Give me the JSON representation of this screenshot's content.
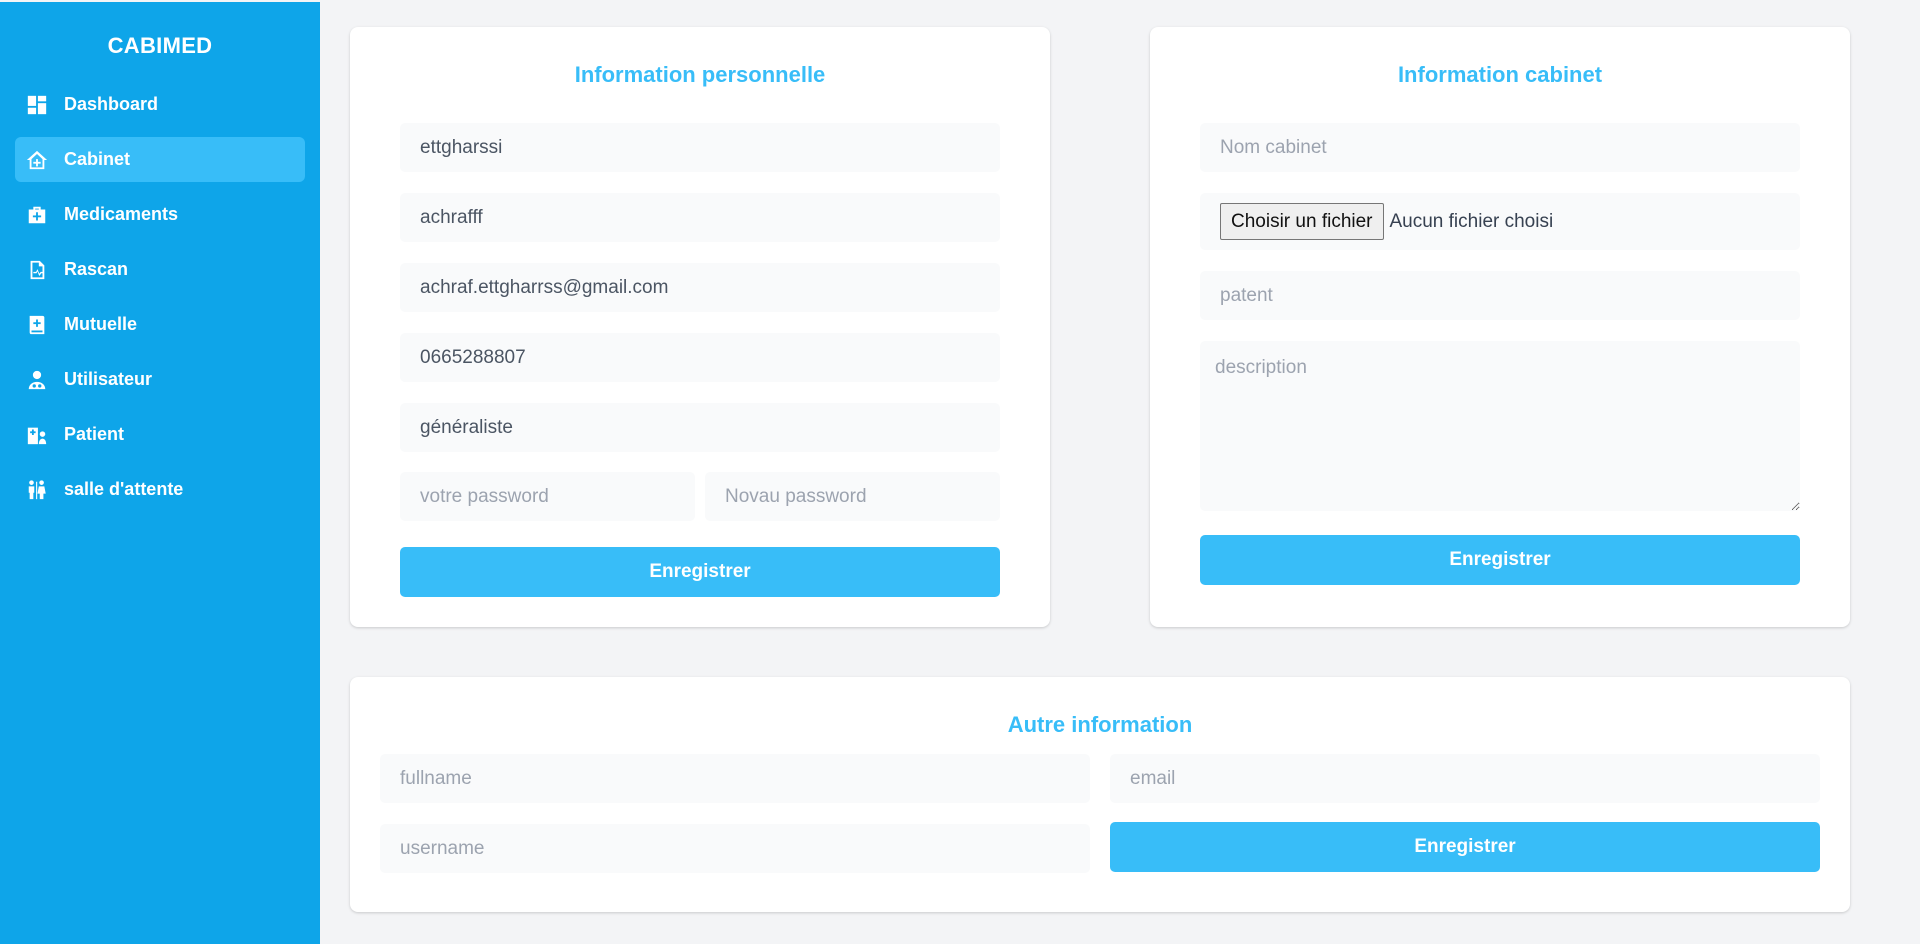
{
  "brand": "CABIMED",
  "nav": [
    {
      "label": "Dashboard",
      "icon": "dashboard-icon"
    },
    {
      "label": "Cabinet",
      "icon": "home-plus-icon",
      "active": true
    },
    {
      "label": "Medicaments",
      "icon": "medical-kit-icon"
    },
    {
      "label": "Rascan",
      "icon": "medical-file-icon"
    },
    {
      "label": "Mutuelle",
      "icon": "medical-book-icon"
    },
    {
      "label": "Utilisateur",
      "icon": "doctor-icon"
    },
    {
      "label": "Patient",
      "icon": "hospital-user-icon"
    },
    {
      "label": "salle d'attente",
      "icon": "people-icon"
    }
  ],
  "personal": {
    "title": "Information personnelle",
    "lastname": "ettgharssi",
    "firstname": "achrafff",
    "email": "achraf.ettgharrss@gmail.com",
    "phone": "0665288807",
    "speciality": "généraliste",
    "password_placeholder": "votre password",
    "new_password_placeholder": "Novau password",
    "save_label": "Enregistrer"
  },
  "cabinet": {
    "title": "Information cabinet",
    "name_placeholder": "Nom cabinet",
    "file_button": "Choisir un fichier",
    "file_status": "Aucun fichier choisi",
    "patent_placeholder": "patent",
    "description_placeholder": "description",
    "save_label": "Enregistrer"
  },
  "other": {
    "title": "Autre information",
    "fullname_placeholder": "fullname",
    "email_placeholder": "email",
    "username_placeholder": "username",
    "save_label": "Enregistrer"
  },
  "colors": {
    "sidebar": "#0ea5e9",
    "accent": "#38bdf8",
    "background": "#f3f4f6"
  }
}
